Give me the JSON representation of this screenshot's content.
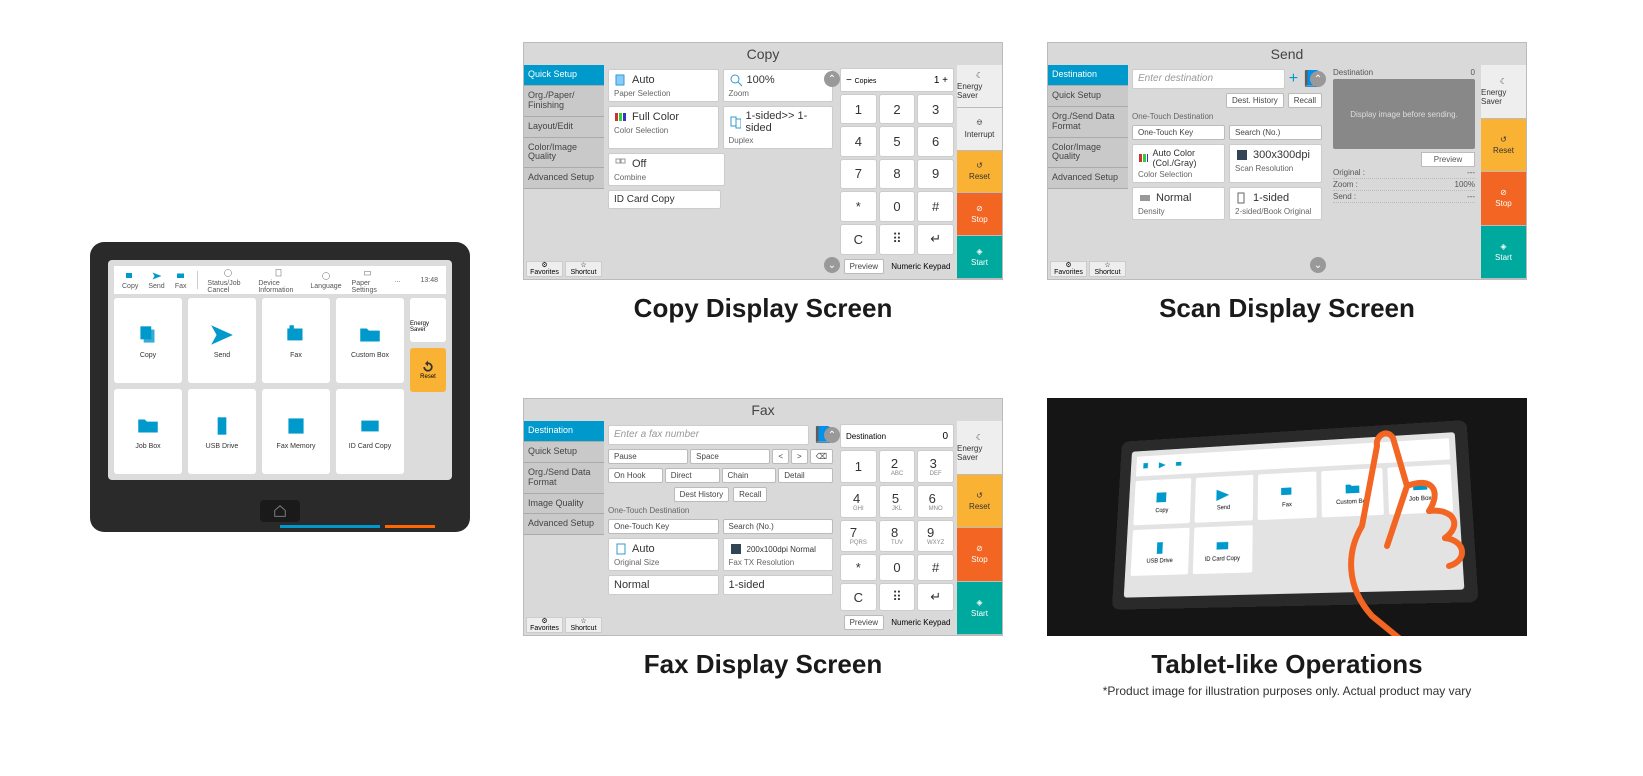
{
  "tablet": {
    "top_items": [
      "Copy",
      "Send",
      "Fax",
      "Status/Job Cancel",
      "Device Information",
      "Language",
      "Paper Settings",
      "..."
    ],
    "time": "13:48",
    "cards": [
      "Copy",
      "Send",
      "Fax",
      "Custom Box",
      "Job Box",
      "USB Drive",
      "Fax Memory",
      "ID Card Copy"
    ],
    "side": {
      "energy": "Energy Saver",
      "reset": "Reset"
    }
  },
  "copy": {
    "title": "Copy",
    "tabs": [
      "Quick Setup",
      "Org./Paper/ Finishing",
      "Layout/Edit",
      "Color/Image Quality",
      "Advanced Setup"
    ],
    "boxes": {
      "paper": {
        "v": "Auto",
        "l": "Paper Selection"
      },
      "zoom": {
        "v": "100%",
        "l": "Zoom"
      },
      "color": {
        "v": "Full Color",
        "l": "Color Selection"
      },
      "duplex": {
        "v": "1-sided>> 1-sided",
        "l": "Duplex"
      },
      "combine": {
        "v": "Off",
        "l": "Combine"
      },
      "idcard": {
        "v": "ID Card Copy"
      }
    },
    "copies_label": "Copies",
    "copies": "1",
    "foot": {
      "fav": "Favorites",
      "sc": "Shortcut"
    },
    "preview": "Preview",
    "numeric": "Numeric Keypad",
    "actions": {
      "es": "Energy Saver",
      "int": "Interrupt",
      "reset": "Reset",
      "stop": "Stop",
      "start": "Start"
    }
  },
  "scan": {
    "title": "Send",
    "tabs": [
      "Destination",
      "Quick Setup",
      "Org./Send Data Format",
      "Color/Image Quality",
      "Advanced Setup"
    ],
    "enter": "Enter destination",
    "btn_hist": "Dest. History",
    "btn_recall": "Recall",
    "otd": "One-Touch Destination",
    "otk": "One-Touch Key",
    "search": "Search (No.)",
    "color": {
      "v": "Auto Color (Col./Gray)",
      "l": "Color Selection"
    },
    "res": {
      "v": "300x300dpi",
      "l": "Scan Resolution"
    },
    "density": {
      "v": "Normal",
      "l": "Density"
    },
    "orig": {
      "v": "1-sided",
      "l": "2-sided/Book Original"
    },
    "dest_label": "Destination",
    "dest_count": "0",
    "preview_msg": "Display image before sending.",
    "preview": "Preview",
    "rows": {
      "orig": "Original :",
      "zoom": "Zoom :",
      "zval": "100%",
      "send": "Send :",
      "dash": "---"
    },
    "foot": {
      "fav": "Favorites",
      "sc": "Shortcut"
    },
    "actions": {
      "es": "Energy Saver",
      "reset": "Reset",
      "stop": "Stop",
      "start": "Start"
    }
  },
  "fax": {
    "title": "Fax",
    "tabs": [
      "Destination",
      "Quick Setup",
      "Org./Send Data Format",
      "Image Quality",
      "Advanced Setup"
    ],
    "enter": "Enter a fax number",
    "row1": [
      "Pause",
      "Space",
      "<",
      ">",
      "⌫"
    ],
    "row2": [
      "On Hook",
      "Direct",
      "Chain",
      "Detail"
    ],
    "btn_hist": "Dest History",
    "btn_recall": "Recall",
    "otd": "One-Touch Destination",
    "otk": "One-Touch Key",
    "search": "Search (No.)",
    "size": {
      "v": "Auto",
      "l": "Original Size"
    },
    "res": {
      "v": "200x100dpi Normal",
      "l": "Fax TX Resolution"
    },
    "density": {
      "v": "Normal"
    },
    "sided": {
      "v": "1-sided"
    },
    "dest_label": "Destination",
    "dest_count": "0",
    "preview": "Preview",
    "numeric": "Numeric Keypad",
    "foot": {
      "fav": "Favorites",
      "sc": "Shortcut"
    },
    "actions": {
      "es": "Energy Saver",
      "reset": "Reset",
      "stop": "Stop",
      "start": "Start"
    }
  },
  "keypad": {
    "keys": [
      [
        "1",
        ""
      ],
      [
        "2",
        "ABC"
      ],
      [
        "3",
        "DEF"
      ],
      [
        "4",
        "GHI"
      ],
      [
        "5",
        "JKL"
      ],
      [
        "6",
        "MNO"
      ],
      [
        "7",
        "PQRS"
      ],
      [
        "8",
        "TUV"
      ],
      [
        "9",
        "WXYZ"
      ],
      [
        "*",
        ""
      ],
      [
        "0",
        ""
      ],
      [
        "#",
        ""
      ]
    ],
    "bottom": [
      "C",
      "⠿",
      "↵"
    ]
  },
  "captions": {
    "copy": "Copy Display Screen",
    "scan": "Scan Display Screen",
    "fax": "Fax Display Screen",
    "ops": "Tablet-like Operations",
    "disclaimer": "*Product image for illustration purposes only. Actual product may vary"
  },
  "photo": {
    "cards": [
      "Copy",
      "Send",
      "Fax",
      "Custom Box",
      "Job Box",
      "USB Drive",
      "ID Card Copy"
    ]
  }
}
